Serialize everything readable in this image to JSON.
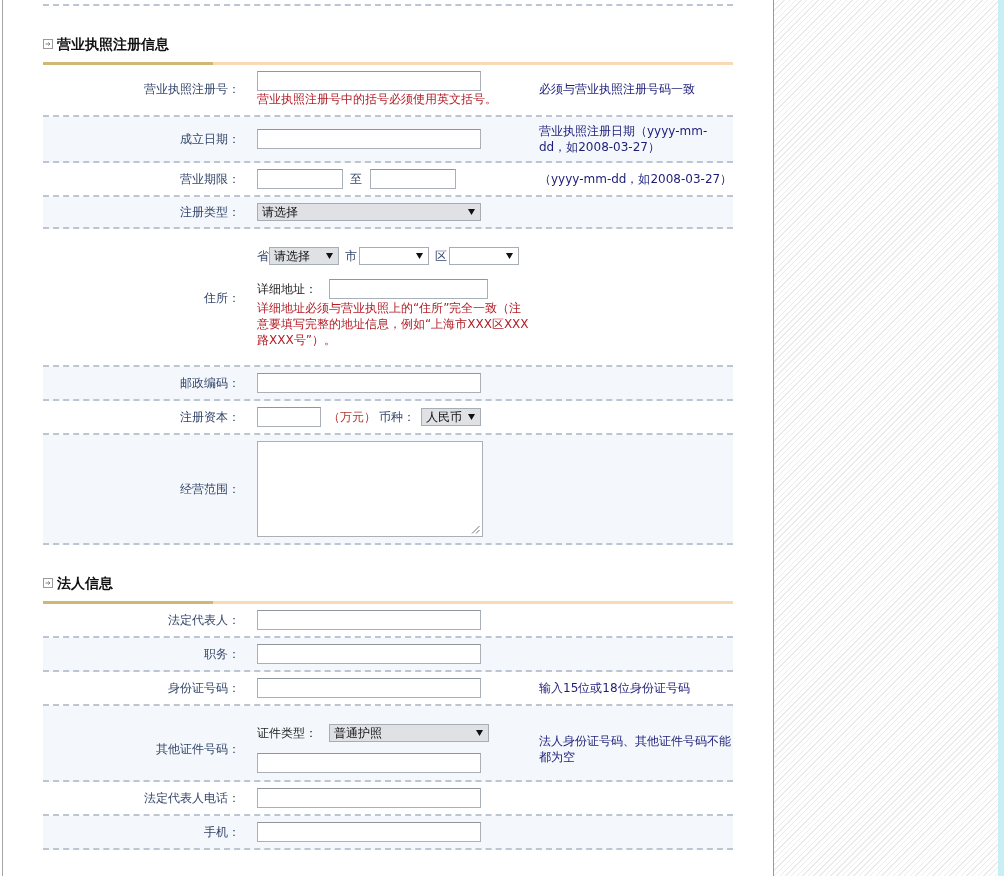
{
  "sections": [
    {
      "title": "营业执照注册信息",
      "rows": [
        {
          "kind": "text",
          "label": "营业执照注册号：",
          "error": "营业执照注册号中的括号必须使用英文括号。",
          "note": "必须与营业执照注册号码一致"
        },
        {
          "kind": "text",
          "label": "成立日期：",
          "note": "营业执照注册日期（yyyy-mm-dd，如2008-03-27）"
        },
        {
          "kind": "range",
          "label": "营业期限：",
          "separator": "至",
          "note": "（yyyy-mm-dd，如2008-03-27）"
        },
        {
          "kind": "select",
          "label": "注册类型：",
          "value": "请选择"
        },
        {
          "kind": "address",
          "label": "住所：",
          "selects": [
            {
              "label": "省",
              "value": "请选择"
            },
            {
              "label": "市"
            },
            {
              "label": "区"
            }
          ],
          "detail_label": "详细地址：",
          "error": "详细地址必须与营业执照上的“住所”完全一致（注意要填写完整的地址信息，例如“上海市XXX区XXX路XXX号”）。"
        },
        {
          "kind": "text",
          "label": "邮政编码："
        },
        {
          "kind": "capital",
          "label": "注册资本：",
          "unit": "（万元）",
          "currency_label": "币种：",
          "currency": "人民币"
        },
        {
          "kind": "textarea",
          "label": "经营范围："
        }
      ]
    },
    {
      "title": "法人信息",
      "rows": [
        {
          "kind": "text",
          "label": "法定代表人："
        },
        {
          "kind": "text",
          "label": "职务："
        },
        {
          "kind": "text",
          "label": "身份证号码：",
          "note": "输入15位或18位身份证号码"
        },
        {
          "kind": "id_other",
          "label": "其他证件号码：",
          "type_label": "证件类型：",
          "type_value": "普通护照",
          "note": "法人身份证号码、其他证件号码不能都为空"
        },
        {
          "kind": "text",
          "label": "法定代表人电话："
        },
        {
          "kind": "text",
          "label": "手机："
        }
      ]
    }
  ]
}
